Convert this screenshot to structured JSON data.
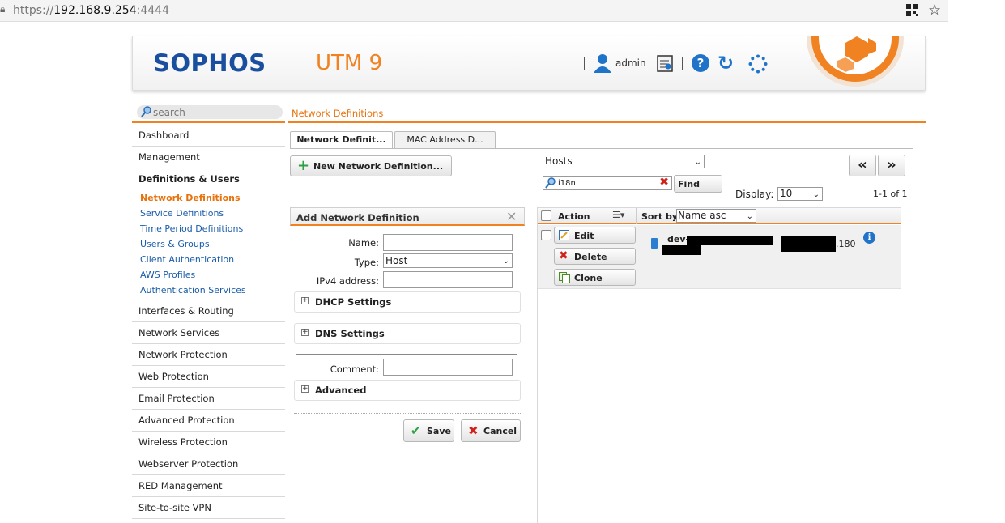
{
  "browser": {
    "url_prefix": "https://",
    "url_host": "192.168.9.254",
    "url_port": ":4444"
  },
  "header": {
    "logo": "SOPHOS",
    "product": "UTM 9",
    "user": "admin"
  },
  "colors": {
    "accent": "#f08222",
    "brand_blue": "#1a4fa0",
    "link": "#1a5ca8"
  },
  "search": {
    "placeholder": "search"
  },
  "nav": {
    "items_before": [
      "Dashboard",
      "Management"
    ],
    "section": "Definitions & Users",
    "sub_items": [
      "Network Definitions",
      "Service Definitions",
      "Time Period Definitions",
      "Users & Groups",
      "Client Authentication",
      "AWS Profiles",
      "Authentication Services"
    ],
    "items_after": [
      "Interfaces & Routing",
      "Network Services",
      "Network Protection",
      "Web Protection",
      "Email Protection",
      "Advanced Protection",
      "Wireless Protection",
      "Webserver Protection",
      "RED Management",
      "Site-to-site VPN"
    ]
  },
  "breadcrumb": "Network Definitions",
  "tabs": [
    "Network Definit...",
    "MAC Address D..."
  ],
  "toolbar": {
    "new_button": "New Network Definition...",
    "type_filter": "Hosts",
    "filter_value": "i18n",
    "find": "Find",
    "display_label": "Display:",
    "display_value": "10",
    "prev": "«",
    "next": "»",
    "count": "1-1 of 1"
  },
  "form": {
    "title": "Add Network Definition",
    "name_label": "Name:",
    "type_label": "Type:",
    "type_value": "Host",
    "ipv4_label": "IPv4 address:",
    "dhcp": "DHCP Settings",
    "dns": "DNS Settings",
    "comment_label": "Comment:",
    "advanced": "Advanced",
    "save": "Save",
    "cancel": "Cancel"
  },
  "list": {
    "action_header": "Action",
    "sortby_label": "Sort by:",
    "sort_value": "Name asc",
    "row": {
      "edit": "Edit",
      "delete": "Delete",
      "clone": "Clone",
      "name_prefix": "dev-",
      "ip_suffix": ".180"
    }
  }
}
